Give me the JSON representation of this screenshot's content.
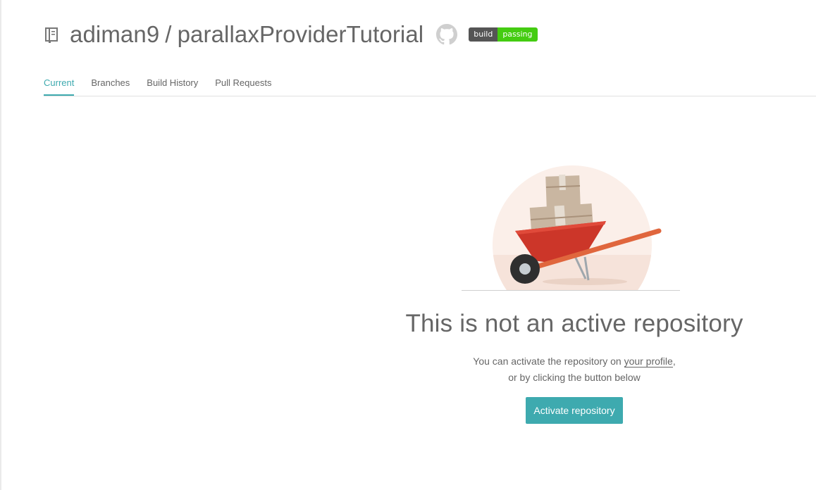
{
  "repo": {
    "owner": "adiman9",
    "separator": "/",
    "name": "parallaxProviderTutorial",
    "icons": {
      "repo": "repo-book-icon",
      "github": "github-icon"
    },
    "badge": {
      "left": "build",
      "right": "passing",
      "right_color": "#44cc11"
    }
  },
  "tabs": [
    {
      "label": "Current",
      "active": true
    },
    {
      "label": "Branches",
      "active": false
    },
    {
      "label": "Build History",
      "active": false
    },
    {
      "label": "Pull Requests",
      "active": false
    }
  ],
  "empty_state": {
    "illustration": "wheelbarrow-with-boxes",
    "headline": "This is not an active repository",
    "line1_prefix": "You can activate the repository on ",
    "profile_link": "your profile",
    "line1_suffix": ",",
    "line2": "or by clicking the button below",
    "button": "Activate repository"
  },
  "colors": {
    "accent": "#3eaaaf",
    "text": "#666666",
    "wheelbarrow": "#cc3629",
    "handle": "#e0663d"
  }
}
